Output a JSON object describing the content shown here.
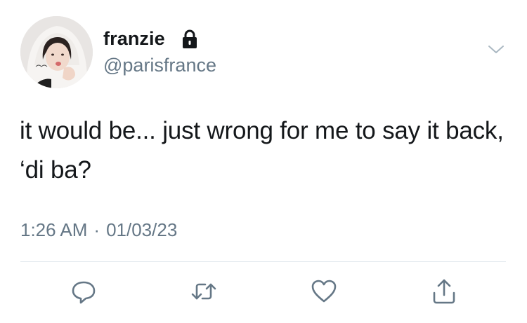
{
  "tweet": {
    "author": {
      "display_name": "franzie",
      "handle": "@parisfrance",
      "protected_icon": "lock-icon",
      "avatar_icon": "profile-photo"
    },
    "text": "it would be... just wrong for me to say it back, ‘di ba?",
    "time": "1:26 AM",
    "separator": "·",
    "date": "01/03/23",
    "menu_icon": "chevron-down-icon",
    "actions": [
      {
        "name": "reply",
        "icon": "reply-icon"
      },
      {
        "name": "retweet",
        "icon": "retweet-icon"
      },
      {
        "name": "like",
        "icon": "heart-icon"
      },
      {
        "name": "share",
        "icon": "share-icon"
      }
    ]
  },
  "colors": {
    "text_primary": "#14171a",
    "text_secondary": "#657786",
    "icon_gray": "#657786",
    "divider": "#e1e8ed"
  }
}
